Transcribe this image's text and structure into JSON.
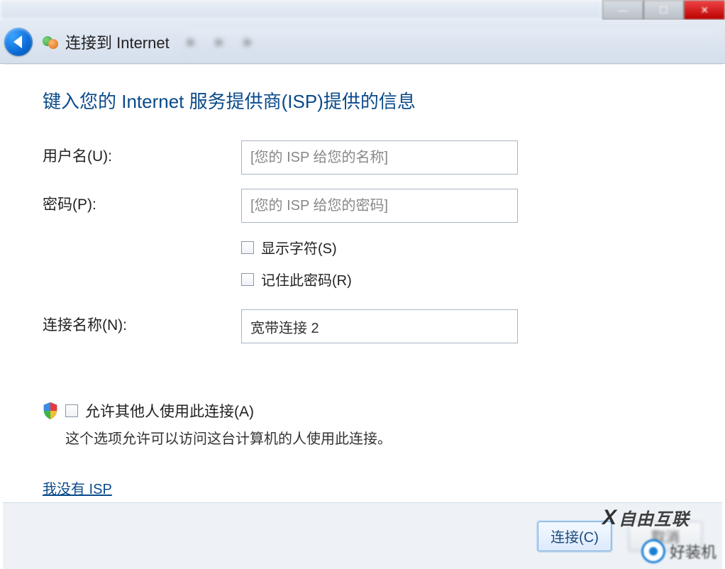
{
  "nav": {
    "title": "连接到 Internet"
  },
  "heading": "键入您的 Internet 服务提供商(ISP)提供的信息",
  "fields": {
    "username_label": "用户名(U):",
    "username_placeholder": "[您的 ISP 给您的名称]",
    "password_label": "密码(P):",
    "password_placeholder": "[您的 ISP 给您的密码]",
    "show_chars_label": "显示字符(S)",
    "remember_pw_label": "记住此密码(R)",
    "conn_name_label": "连接名称(N):",
    "conn_name_value": "宽带连接 2",
    "allow_others_label": "允许其他人使用此连接(A)",
    "allow_others_desc": "这个选项允许可以访问这台计算机的人使用此连接。"
  },
  "link_no_isp": "我没有 ISP",
  "buttons": {
    "connect": "连接(C)",
    "cancel": "取消"
  },
  "watermarks": {
    "w1": "自由互联",
    "w2": "好装机"
  }
}
